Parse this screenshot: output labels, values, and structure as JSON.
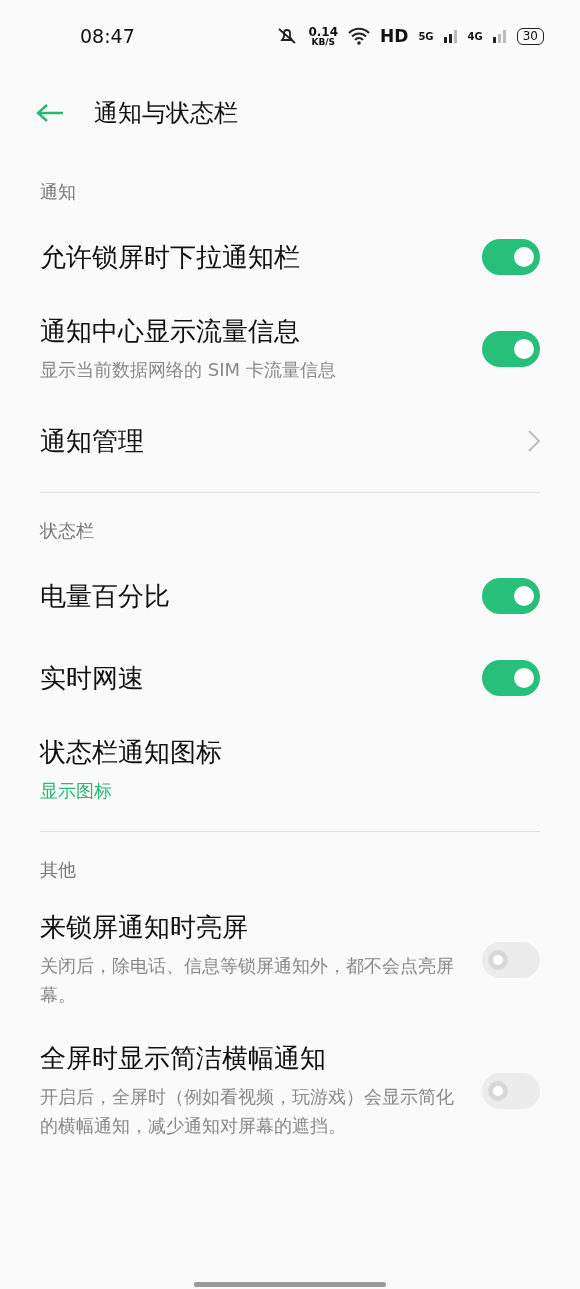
{
  "status_bar": {
    "time": "08:47",
    "speed": "0.14",
    "speed_unit": "KB/S",
    "hd": "HD",
    "network_1": "5G",
    "network_2": "4G",
    "battery": "30"
  },
  "header": {
    "title": "通知与状态栏"
  },
  "sections": [
    {
      "label": "通知",
      "items": [
        {
          "kind": "toggle",
          "title": "允许锁屏时下拉通知栏",
          "on": true
        },
        {
          "kind": "toggle",
          "title": "通知中心显示流量信息",
          "subtitle": "显示当前数据网络的 SIM 卡流量信息",
          "on": true
        },
        {
          "kind": "link",
          "title": "通知管理"
        }
      ]
    },
    {
      "label": "状态栏",
      "items": [
        {
          "kind": "toggle",
          "title": "电量百分比",
          "on": true
        },
        {
          "kind": "toggle",
          "title": "实时网速",
          "on": true
        },
        {
          "kind": "detail",
          "title": "状态栏通知图标",
          "value": "显示图标"
        }
      ]
    },
    {
      "label": "其他",
      "items": [
        {
          "kind": "toggle",
          "title": "来锁屏通知时亮屏",
          "subtitle": "关闭后，除电话、信息等锁屏通知外，都不会点亮屏幕。",
          "on": false
        },
        {
          "kind": "toggle",
          "title": "全屏时显示简洁横幅通知",
          "subtitle": "开启后，全屏时（例如看视频，玩游戏）会显示简化的横幅通知，减少通知对屏幕的遮挡。",
          "on": false
        }
      ]
    }
  ]
}
